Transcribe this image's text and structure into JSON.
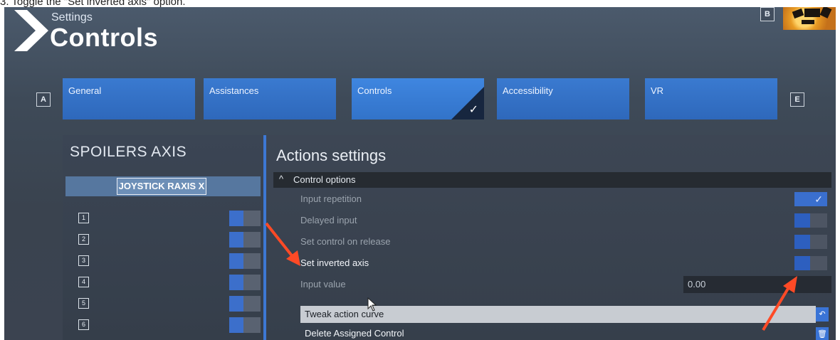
{
  "caption": "3. Toggle the \"Set inverted axis\" option.",
  "header": {
    "settings_label": "Settings",
    "title": "Controls",
    "key_b": "B",
    "key_a": "A",
    "key_e": "E"
  },
  "tabs": [
    {
      "label": "General"
    },
    {
      "label": "Assistances"
    },
    {
      "label": "Controls"
    },
    {
      "label": "Accessibility"
    },
    {
      "label": "VR"
    }
  ],
  "left_panel": {
    "title": "SPOILERS AXIS",
    "binding": "JOYSTICK RAXIS X",
    "slots": [
      "1",
      "2",
      "3",
      "4",
      "5",
      "6"
    ]
  },
  "actions": {
    "title": "Actions settings",
    "section": "Control options",
    "options": [
      {
        "label": "Input repetition",
        "state": "on"
      },
      {
        "label": "Delayed input",
        "state": "off"
      },
      {
        "label": "Set control on release",
        "state": "off"
      },
      {
        "label": "Set inverted axis",
        "state": "off"
      }
    ],
    "input_value_label": "Input value",
    "input_value": "0.00",
    "tweak_label": "Tweak action curve",
    "delete_label": "Delete Assigned Control"
  },
  "colors": {
    "accent": "#3a7ad0",
    "annotation": "#ff4a26"
  }
}
